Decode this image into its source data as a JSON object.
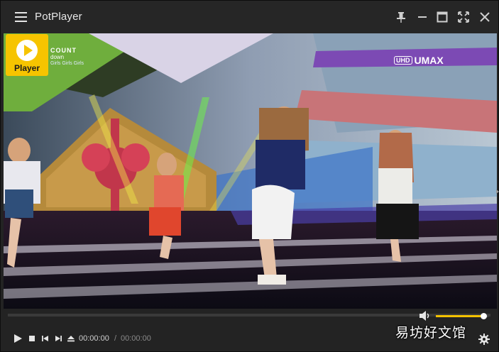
{
  "titlebar": {
    "app_title": "PotPlayer",
    "icons": [
      "menu-icon",
      "pin-icon",
      "minimize-icon",
      "maximize-icon",
      "fullscreen-icon",
      "close-icon"
    ]
  },
  "video": {
    "player_badge_label": "Player",
    "channel_logo": {
      "line1": "COUNT",
      "line2": "down",
      "line3": "Girls Girls Girls"
    },
    "broadcaster": {
      "uhd": "UHD",
      "brand": "UMAX"
    }
  },
  "controls": {
    "current_time": "00:00:00",
    "separator": "/",
    "duration": "00:00:00",
    "icons": [
      "play-icon",
      "stop-icon",
      "previous-icon",
      "next-icon",
      "eject-icon",
      "volume-icon",
      "settings-gear-icon"
    ],
    "volume_level": 0.9,
    "seek_progress": 0
  },
  "watermark": "易坊好文馆",
  "colors": {
    "accent": "#f3c200",
    "badge": "#f6c400",
    "titlebar_bg": "#262626",
    "window_bg": "#232323"
  }
}
